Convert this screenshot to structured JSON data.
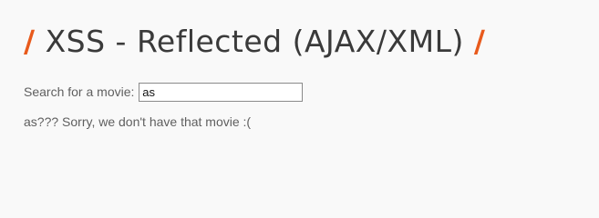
{
  "header": {
    "title": "XSS - Reflected (AJAX/XML)",
    "slash_left": "/",
    "slash_right": "/"
  },
  "search": {
    "label": "Search for a movie:",
    "value": "as"
  },
  "result": {
    "text": "as??? Sorry, we don't have that movie :("
  },
  "colors": {
    "accent": "#e85a1c",
    "background": "#f9f9f9",
    "text": "#5f5f5f"
  }
}
